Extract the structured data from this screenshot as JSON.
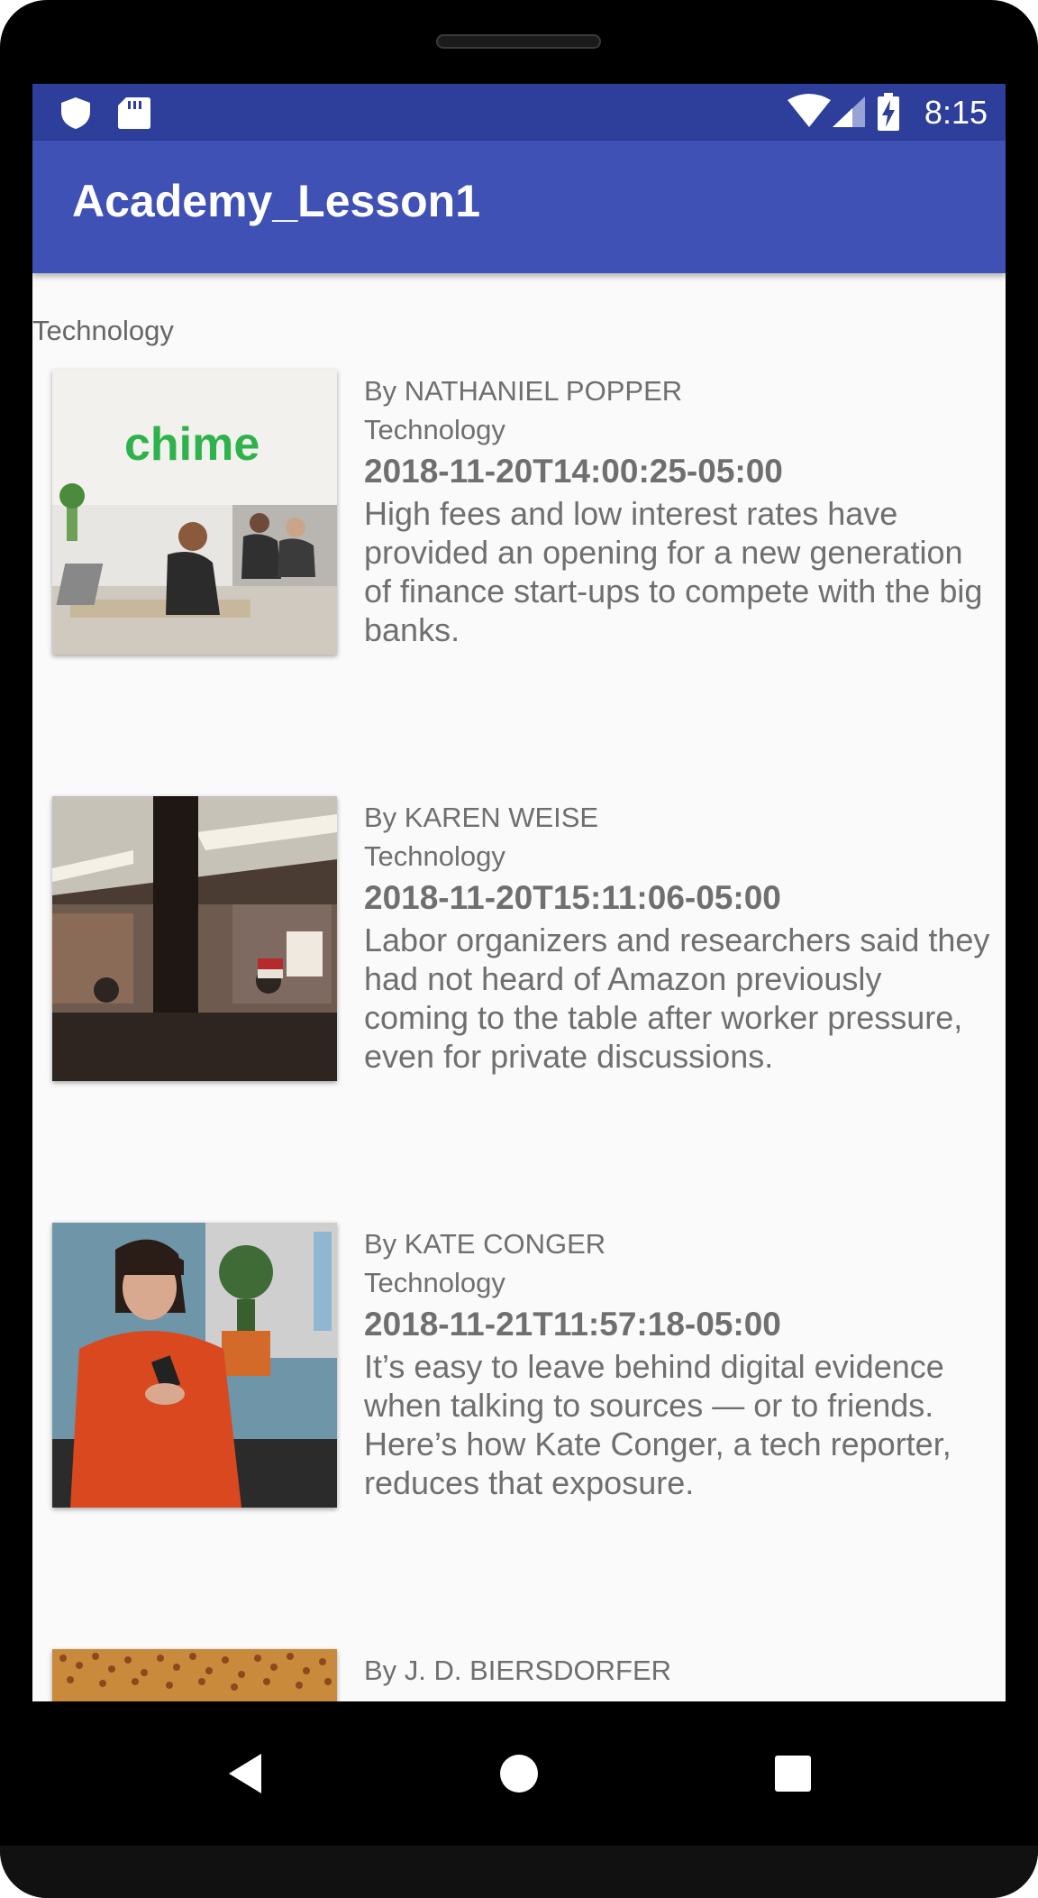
{
  "status_bar": {
    "time": "8:15",
    "left_icons": [
      "shield-icon",
      "sd-card-icon"
    ],
    "right_icons": [
      "wifi-icon",
      "cell-signal-icon",
      "battery-charging-icon"
    ]
  },
  "app_bar": {
    "title": "Academy_Lesson1"
  },
  "section_header": "Technology",
  "articles": [
    {
      "byline": "By NATHANIEL POPPER",
      "section": "Technology",
      "date": "2018-11-20T14:00:25-05:00",
      "abstract": "High fees and low interest rates have provided an opening for a new generation of finance start-ups to compete with the big banks.",
      "image_text": "chime"
    },
    {
      "byline": "By KAREN WEISE",
      "section": "Technology",
      "date": "2018-11-20T15:11:06-05:00",
      "abstract": "Labor organizers and researchers said they had not heard of Amazon previously coming to the table after worker pressure, even for private discussions."
    },
    {
      "byline": "By KATE CONGER",
      "section": "Technology",
      "date": "2018-11-21T11:57:18-05:00",
      "abstract": "It’s easy to leave behind digital evidence when talking to sources — or to friends. Here’s how Kate Conger, a tech reporter, reduces that exposure."
    },
    {
      "byline": "By J. D. BIERSDORFER"
    }
  ],
  "nav_bar": {
    "icons": [
      "back-icon",
      "home-icon",
      "recents-icon"
    ]
  }
}
